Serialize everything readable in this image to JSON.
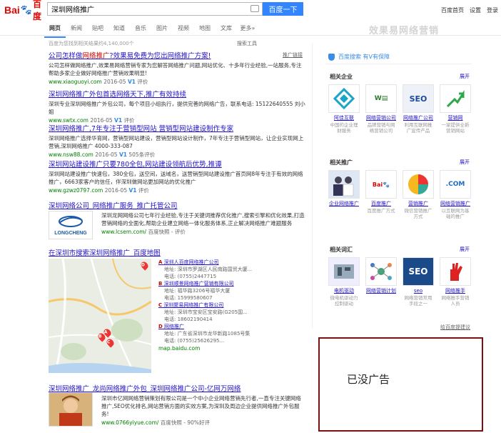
{
  "header": {
    "logo_text": "Bai",
    "logo_paw": "🐾",
    "logo_cn": "百度",
    "search_value": "深圳网络推广",
    "search_button": "百度一下",
    "top_links": [
      "百度首页",
      "设置",
      "登录"
    ]
  },
  "tabs": [
    {
      "label": "网页",
      "active": true
    },
    {
      "label": "新闻",
      "active": false
    },
    {
      "label": "贴吧",
      "active": false
    },
    {
      "label": "知道",
      "active": false
    },
    {
      "label": "音乐",
      "active": false
    },
    {
      "label": "图片",
      "active": false
    },
    {
      "label": "视频",
      "active": false
    },
    {
      "label": "地图",
      "active": false
    },
    {
      "label": "文库",
      "active": false
    },
    {
      "label": "更多»",
      "active": false
    }
  ],
  "watermark": "效果易网络营销",
  "result_stats": "百度为您找到相关结果约4,140,000个",
  "search_tools": "搜索工具",
  "results": [
    {
      "title_pre": "公司怎样做",
      "title_em": "网络推广",
      "title_post": "?效果易免费为您出网络推广方案!",
      "desc": "公司怎样做网络推广,效果易网络营销专家为您解答网络推广问题,网站优化、十多年行业经验,一站服务,专注帮助多家企业做好网络推广营销效果明显!",
      "url": "www.xiaoguoyi.com",
      "date": "2016-05",
      "v": "V1",
      "tag": "评价",
      "ad": "推广链接"
    },
    {
      "title_pre": "深圳网络推广外包首选网络天下,推广有效持续",
      "title_em": "",
      "title_post": "",
      "desc": "深圳专业深圳网络推广外包公司，每个项目小组执行，提供完善的网络广告，联系电话: 15122640555 刘小姐",
      "url": "www.swtx.com",
      "date": "2016-05",
      "v": "V1",
      "tag": "评价",
      "ad": ""
    },
    {
      "title_pre": "深圳网络推广,7年专注于营销型网站  营销型网站建设制作专家",
      "title_em": "",
      "title_post": "",
      "desc": "深圳网络推广选择华育网，营销型网站建设，营销型网站设计制作，7年专注于营销型网站，让企业实现网上营销,深圳网络推广 4000-333-087",
      "url": "www.nsw88.com",
      "date": "2016-05",
      "v": "V1",
      "tag": "505条评价",
      "ad": ""
    },
    {
      "title_pre": "深圳网站建设推广只要780全包,网站建设领航后优势,推谭",
      "title_em": "",
      "title_post": "",
      "desc": "深圳网站建设推广快速包，380全包，送空间，送域名，送营销型网站建设推广首页网8年专注于有效的网络推广，6663家客户的信任，伴深圳做网站更加网站的优化推广",
      "url": "www.gzwz0797.com",
      "date": "2016-05",
      "v": "V1",
      "tag": "评价",
      "ad": ""
    },
    {
      "title_pre": "深圳网络公司_网络推广服务_推广托管公司",
      "title_em": "",
      "title_post": "",
      "desc": "深圳龙网网络公司七年行业经验,专注于关键词推荐优化推广,搜索引擎和优化效果,打造营销网络的全面化,帮助企业建立网络一体化服务体系,正止解决网络推广难题服务",
      "url": "www.lcsem.com/",
      "date": "",
      "v": "",
      "tag": "百度快照 - 评价",
      "ad": "",
      "logo": "LONGCHENG"
    }
  ],
  "map_card": {
    "title": "在深圳市搜索深圳网络推广_百度地图",
    "url": "map.baidu.com",
    "pois": [
      {
        "letter": "A",
        "name": "深圳人百度网络推广公司",
        "addr": "地址: 深圳市罗湖区人民南路国贸大厦...",
        "phone": "电话: (0755)2447715"
      },
      {
        "letter": "B",
        "name": "深圳顺景网络推广营销有限公司",
        "addr": "地址: 福华路3206号福华大厦",
        "phone": "电话: 15999580607"
      },
      {
        "letter": "C",
        "name": "深圳聚易网络推广有限公司",
        "addr": "地址: 深圳市宝安区宝安路(G205国...",
        "phone": "电话: 18602190414"
      },
      {
        "letter": "D",
        "name": "网络推广",
        "addr": "地址: 广东省深圳市龙华新路1085号集",
        "phone": "电话: (0755)25626295..."
      }
    ]
  },
  "last_result": {
    "title": "深圳网络推广_龙尚网络推广外包_深圳网络推广公司-亿网万网络",
    "desc": "深圳市亿网网络营销策划有限公司是一个中小企业网络营销先行者,一直专注关键网络推广,SEO优化排名,网站营销方面的实效方案,为深圳及周边企业提供网络推广外包服务!",
    "url": "www.0766yiyue.com/",
    "tag": "百度快照 - 90%好评"
  },
  "right_col": {
    "safe_text": "百度搜索  有V有保障",
    "sections": [
      {
        "head": "相关企业",
        "more": "展开",
        "items": [
          {
            "name": "阿佳互联",
            "sub": "中国的企业理财服务"
          },
          {
            "name": "网络营销公司",
            "sub": "品牌营销与网络营销公司"
          },
          {
            "name": "网络推广公司",
            "sub": "利用互联网推广宣传产品"
          },
          {
            "name": "营销网",
            "sub": "一家提供全新营销网站"
          }
        ]
      },
      {
        "head": "相关推广",
        "more": "展开",
        "items": [
          {
            "name": "企业网络推广",
            "sub": ""
          },
          {
            "name": "百度推广",
            "sub": "百度推广方式"
          },
          {
            "name": "营销推广",
            "sub": "微信营销推广方式"
          },
          {
            "name": "网络营销推广",
            "sub": "以互联网为基础的推广"
          }
        ]
      },
      {
        "head": "相关词汇",
        "more": "展开",
        "items": [
          {
            "name": "电机驱动",
            "sub": "微电机驱动力控制驱动"
          },
          {
            "name": "网络营销计划",
            "sub": ""
          },
          {
            "name": "seo",
            "sub": "网络营销常用手段之一"
          },
          {
            "name": "网络推手",
            "sub": "网络推手营销人员"
          }
        ]
      }
    ],
    "feedback": "给百度提建议"
  },
  "noad_text": "已没广告",
  "colors": {
    "link": "#2011cd",
    "em": "#cc0000",
    "url": "#008000",
    "accent": "#3385ff",
    "box_border": "#7a1010"
  }
}
